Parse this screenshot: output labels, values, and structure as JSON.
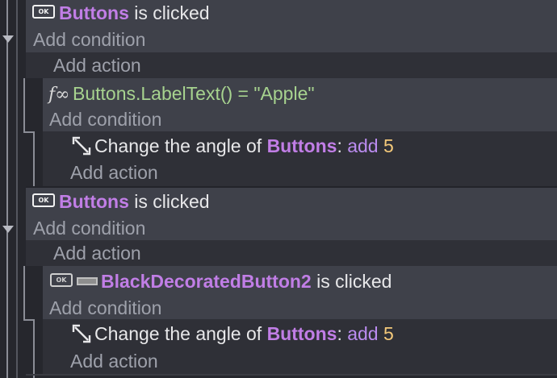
{
  "events": [
    {
      "condition_object": "Buttons",
      "condition_text": "is clicked",
      "add_condition": "Add condition",
      "add_action": "Add action",
      "sub_event": {
        "condition_expression": "Buttons.LabelText() = \"Apple\"",
        "add_condition": "Add condition",
        "action_prefix": "Change the angle of",
        "action_object": "Buttons",
        "action_colon": ":",
        "action_op": "add",
        "action_value": "5",
        "add_action": "Add action"
      }
    },
    {
      "condition_object": "Buttons",
      "condition_text": "is clicked",
      "add_condition": "Add condition",
      "add_action": "Add action",
      "sub_event": {
        "condition_object": "BlackDecoratedButton2",
        "condition_text": "is clicked",
        "add_condition": "Add condition",
        "action_prefix": "Change the angle of",
        "action_object": "Buttons",
        "action_colon": ":",
        "action_op": "add",
        "action_value": "5",
        "add_action": "Add action"
      }
    }
  ],
  "icons": {
    "ok_badge": "OK",
    "collapse": "caret-down-icon",
    "expression": "fx-icon",
    "angle": "angle-arrow-icon",
    "button_object": "black-button-icon"
  }
}
